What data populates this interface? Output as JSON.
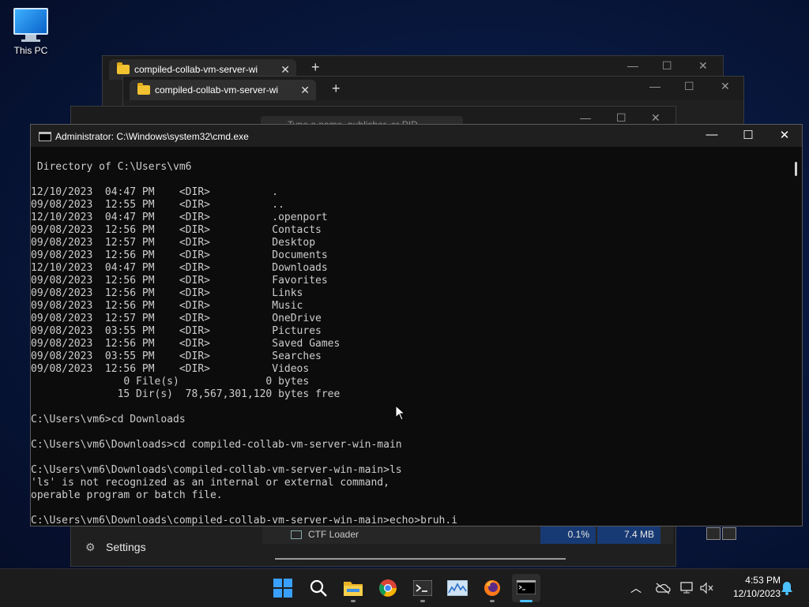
{
  "desktop": {
    "icon_label": "This PC"
  },
  "explorer_back": {
    "tab_title": "compiled-collab-vm-server-wi",
    "new_tab": "+"
  },
  "explorer_front": {
    "tab_title": "compiled-collab-vm-server-wi",
    "new_tab": "+"
  },
  "task_manager": {
    "search_placeholder": "Type a name, publisher, or PID",
    "settings_label": "Settings",
    "row": {
      "name": "CTF Loader",
      "cpu": "0.1%",
      "memory": "7.4 MB"
    }
  },
  "cmd": {
    "title": "Administrator: C:\\Windows\\system32\\cmd.exe",
    "lines": [
      " Directory of C:\\Users\\vm6",
      "",
      "12/10/2023  04:47 PM    <DIR>          .",
      "09/08/2023  12:55 PM    <DIR>          ..",
      "12/10/2023  04:47 PM    <DIR>          .openport",
      "09/08/2023  12:56 PM    <DIR>          Contacts",
      "09/08/2023  12:57 PM    <DIR>          Desktop",
      "09/08/2023  12:56 PM    <DIR>          Documents",
      "12/10/2023  04:47 PM    <DIR>          Downloads",
      "09/08/2023  12:56 PM    <DIR>          Favorites",
      "09/08/2023  12:56 PM    <DIR>          Links",
      "09/08/2023  12:56 PM    <DIR>          Music",
      "09/08/2023  12:57 PM    <DIR>          OneDrive",
      "09/08/2023  03:55 PM    <DIR>          Pictures",
      "09/08/2023  12:56 PM    <DIR>          Saved Games",
      "09/08/2023  03:55 PM    <DIR>          Searches",
      "09/08/2023  12:56 PM    <DIR>          Videos",
      "               0 File(s)              0 bytes",
      "              15 Dir(s)  78,567,301,120 bytes free",
      "",
      "C:\\Users\\vm6>cd Downloads",
      "",
      "C:\\Users\\vm6\\Downloads>cd compiled-collab-vm-server-win-main",
      "",
      "C:\\Users\\vm6\\Downloads\\compiled-collab-vm-server-win-main>ls",
      "'ls' is not recognized as an internal or external command,",
      "operable program or batch file.",
      "",
      "C:\\Users\\vm6\\Downloads\\compiled-collab-vm-server-win-main>echo>bruh.i"
    ]
  },
  "taskbar": {
    "apps": [
      "start-icon",
      "search-icon",
      "file-explorer-icon",
      "chrome-icon",
      "terminal-icon",
      "resource-monitor-icon",
      "firefox-icon",
      "cmd-icon"
    ],
    "time": "4:53 PM",
    "date": "12/10/2023"
  },
  "colors": {
    "accent": "#4cc2ff",
    "terminal_bg": "#0c0c0c",
    "terminal_fg": "#cccccc",
    "taskbar_bg": "#1c1c1c"
  }
}
